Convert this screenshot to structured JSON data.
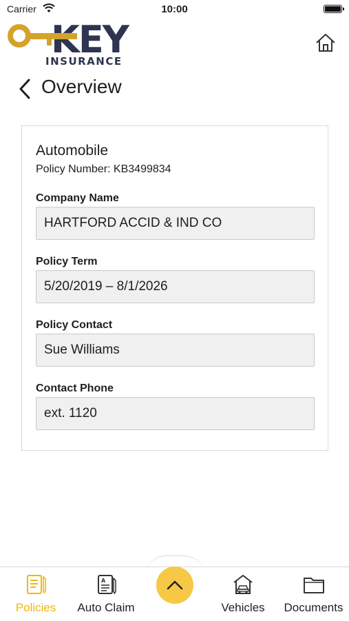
{
  "status_bar": {
    "carrier": "Carrier",
    "time": "10:00"
  },
  "brand": {
    "logo_word": "KEY",
    "logo_sub": "INSURANCE",
    "colors": {
      "gold": "#D4A32A",
      "navy": "#2E3550",
      "accent": "#F2B705"
    }
  },
  "header": {
    "title": "Overview"
  },
  "policy": {
    "type": "Automobile",
    "number_text": "Policy Number: KB3499834",
    "fields": [
      {
        "label": "Company Name",
        "value": "HARTFORD ACCID & IND CO"
      },
      {
        "label": "Policy Term",
        "value": "5/20/2019 – 8/1/2026"
      },
      {
        "label": "Policy Contact",
        "value": "Sue Williams"
      },
      {
        "label": "Contact Phone",
        "value": "ext. 1120"
      }
    ]
  },
  "tabbar": {
    "tabs": [
      {
        "label": "Policies",
        "icon": "document-pen-icon",
        "active": true
      },
      {
        "label": "Auto Claim",
        "icon": "claim-form-icon",
        "active": false
      },
      {
        "label": "Vehicles",
        "icon": "garage-car-icon",
        "active": false
      },
      {
        "label": "Documents",
        "icon": "folder-icon",
        "active": false
      }
    ],
    "center_icon": "chevron-up-icon"
  }
}
